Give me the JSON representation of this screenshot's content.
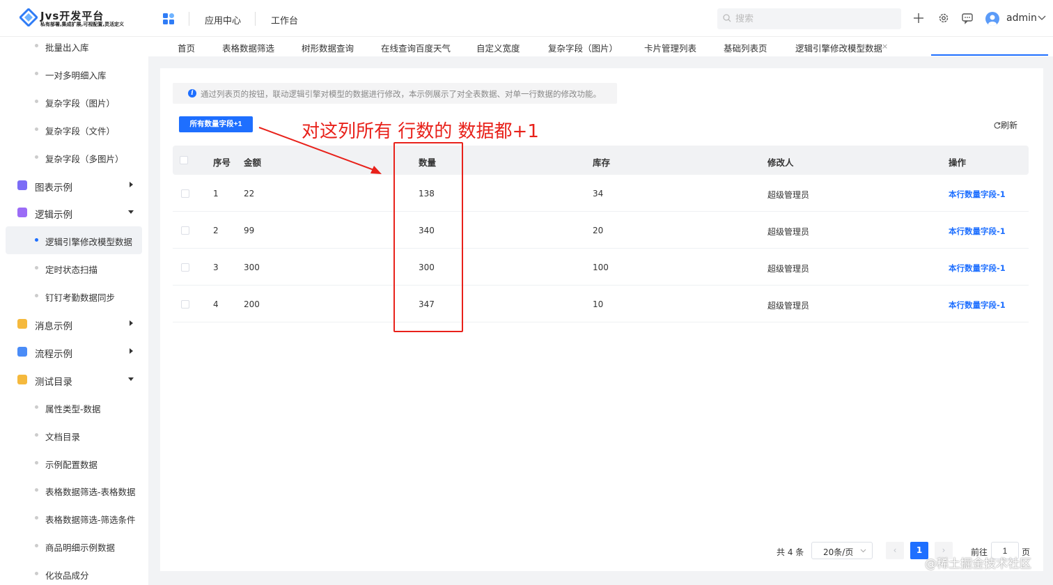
{
  "header": {
    "logo_title": "Jvs开发平台",
    "logo_subtitle": "私有部署,集成扩展,可视配置,灵活定义",
    "nav": [
      "应用中心",
      "工作台"
    ],
    "search_placeholder": "搜索",
    "username": "admin"
  },
  "sidebar": {
    "items": [
      {
        "label": "批量出入库",
        "type": "sub"
      },
      {
        "label": "一对多明细入库",
        "type": "sub"
      },
      {
        "label": "复杂字段（图片）",
        "type": "sub"
      },
      {
        "label": "复杂字段（文件）",
        "type": "sub"
      },
      {
        "label": "复杂字段（多图片）",
        "type": "sub"
      },
      {
        "label": "图表示例",
        "type": "group",
        "caret": "right",
        "icon_color": "#7b6cf6"
      },
      {
        "label": "逻辑示例",
        "type": "group",
        "caret": "down",
        "icon_color": "#9b6cf6"
      },
      {
        "label": "逻辑引擎修改模型数据",
        "type": "sub",
        "active": true
      },
      {
        "label": "定时状态扫描",
        "type": "sub"
      },
      {
        "label": "钉钉考勤数据同步",
        "type": "sub"
      },
      {
        "label": "消息示例",
        "type": "group",
        "caret": "right",
        "icon_color": "#f5b93d"
      },
      {
        "label": "流程示例",
        "type": "group",
        "caret": "right",
        "icon_color": "#4a8cf7"
      },
      {
        "label": "测试目录",
        "type": "group",
        "caret": "down",
        "icon_color": "#f5b93d"
      },
      {
        "label": "属性类型-数据",
        "type": "sub"
      },
      {
        "label": "文档目录",
        "type": "sub"
      },
      {
        "label": "示例配置数据",
        "type": "sub"
      },
      {
        "label": "表格数据筛选-表格数据",
        "type": "sub"
      },
      {
        "label": "表格数据筛选-筛选条件",
        "type": "sub"
      },
      {
        "label": "商品明细示例数据",
        "type": "sub"
      },
      {
        "label": "化妆品成分",
        "type": "sub"
      }
    ]
  },
  "tabs": [
    "首页",
    "表格数据筛选",
    "树形数据查询",
    "在线查询百度天气",
    "自定义宽度",
    "复杂字段（图片）",
    "卡片管理列表",
    "基础列表页",
    "逻辑引擎修改模型数据"
  ],
  "tab_close": "×",
  "main": {
    "notice": "通过列表页的按钮，联动逻辑引擎对模型的数据进行修改，本示例展示了对全表数据、对单一行数据的修改功能。",
    "primary_button": "所有数量字段+1",
    "refresh": "刷新",
    "annotation": "对这列所有 行数的 数据都+1"
  },
  "table": {
    "columns": [
      "序号",
      "金额",
      "数量",
      "库存",
      "修改人",
      "操作"
    ],
    "rows": [
      {
        "index": "1",
        "amount": "22",
        "qty": "138",
        "stock": "34",
        "modifier": "超级管理员",
        "action": "本行数量字段-1"
      },
      {
        "index": "2",
        "amount": "99",
        "qty": "340",
        "stock": "20",
        "modifier": "超级管理员",
        "action": "本行数量字段-1"
      },
      {
        "index": "3",
        "amount": "300",
        "qty": "300",
        "stock": "100",
        "modifier": "超级管理员",
        "action": "本行数量字段-1"
      },
      {
        "index": "4",
        "amount": "200",
        "qty": "347",
        "stock": "10",
        "modifier": "超级管理员",
        "action": "本行数量字段-1"
      }
    ]
  },
  "pagination": {
    "total": "共 4 条",
    "page_size": "20条/页",
    "prev": "‹",
    "current": "1",
    "next": "›",
    "goto_label": "前往",
    "goto_value": "1",
    "page_suffix": "页"
  },
  "watermark": "@稀土掘金技术社区",
  "colors": {
    "primary": "#1e6fff",
    "annotation": "#e8211a"
  }
}
